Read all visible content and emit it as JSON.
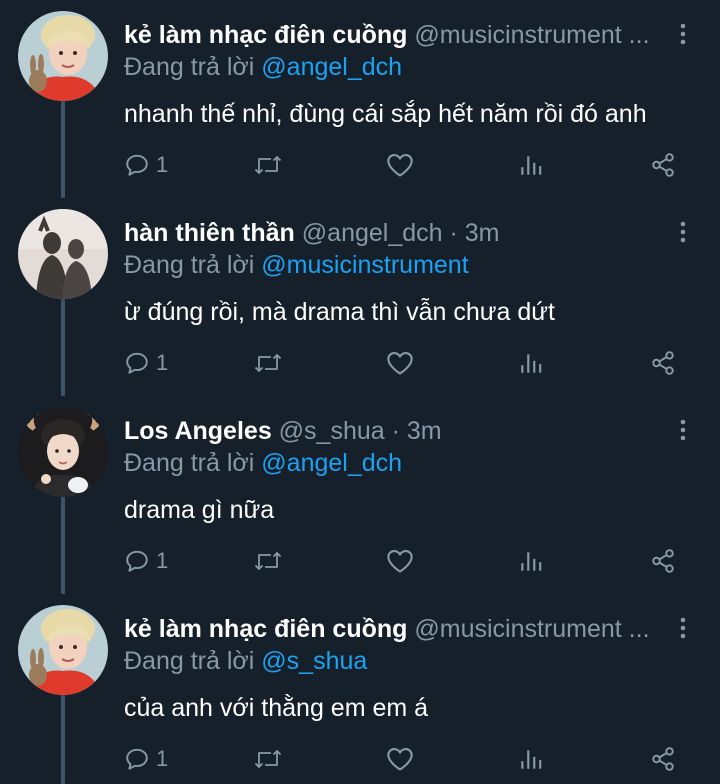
{
  "tweets": [
    {
      "name": "kẻ làm nhạc điên cuồng",
      "handle": "@musicinstrument ...",
      "separator": "",
      "time": "",
      "reply_prefix": "Đang trả lời ",
      "reply_to": "@angel_dch",
      "text": "nhanh thế nhỉ, đùng cái sắp hết năm rồi đó anh",
      "reply_count": "1"
    },
    {
      "name": "hàn thiên thần",
      "handle": "@angel_dch",
      "separator": " · ",
      "time": "3m",
      "reply_prefix": "Đang trả lời ",
      "reply_to": "@musicinstrument",
      "text": "ừ đúng rồi, mà drama thì vẫn chưa dứt",
      "reply_count": "1"
    },
    {
      "name": "Los Angeles",
      "handle": "@s_shua",
      "separator": " · ",
      "time": "3m",
      "reply_prefix": "Đang trả lời ",
      "reply_to": "@angel_dch",
      "text": "drama gì nữa",
      "reply_count": "1"
    },
    {
      "name": "kẻ làm nhạc điên cuồng",
      "handle": "@musicinstrument ...",
      "separator": "",
      "time": "",
      "reply_prefix": "Đang trả lời ",
      "reply_to": "@s_shua",
      "text": "của anh với thằng em em á",
      "reply_count": "1"
    }
  ],
  "icons": {
    "reply": "reply-bubble-icon",
    "retweet": "retweet-icon",
    "like": "heart-icon",
    "stats": "analytics-bars-icon",
    "share": "share-icon",
    "more": "more-vertical-icon"
  },
  "colors": {
    "background": "#15202b",
    "name": "#ffffff",
    "secondary": "#8899a6",
    "mention": "#1da1f2",
    "thread_line": "#3d5466"
  }
}
